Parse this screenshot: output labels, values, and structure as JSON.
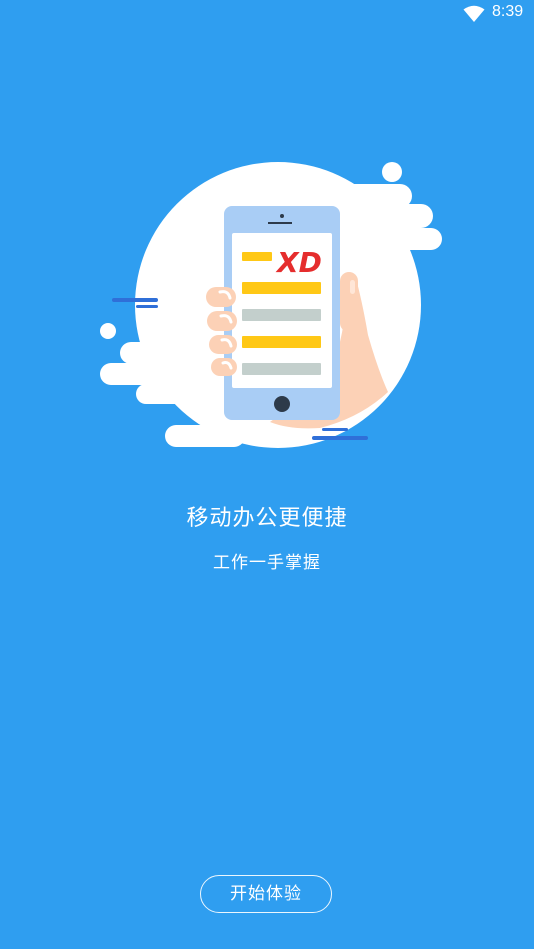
{
  "status_bar": {
    "time": "8:39",
    "wifi_icon": "wifi-icon"
  },
  "illustration": {
    "logo_text": "XD",
    "colors": {
      "background": "#2f9ef0",
      "circle": "#ffffff",
      "phone_frame": "#a9cdf5",
      "yellow_bar": "#ffc816",
      "gray_bar": "#c3cfcc",
      "logo_red": "#e52d2d",
      "skin": "#fcd1b6"
    }
  },
  "main": {
    "title": "移动办公更便捷",
    "subtitle": "工作一手掌握",
    "start_button": "开始体验"
  }
}
